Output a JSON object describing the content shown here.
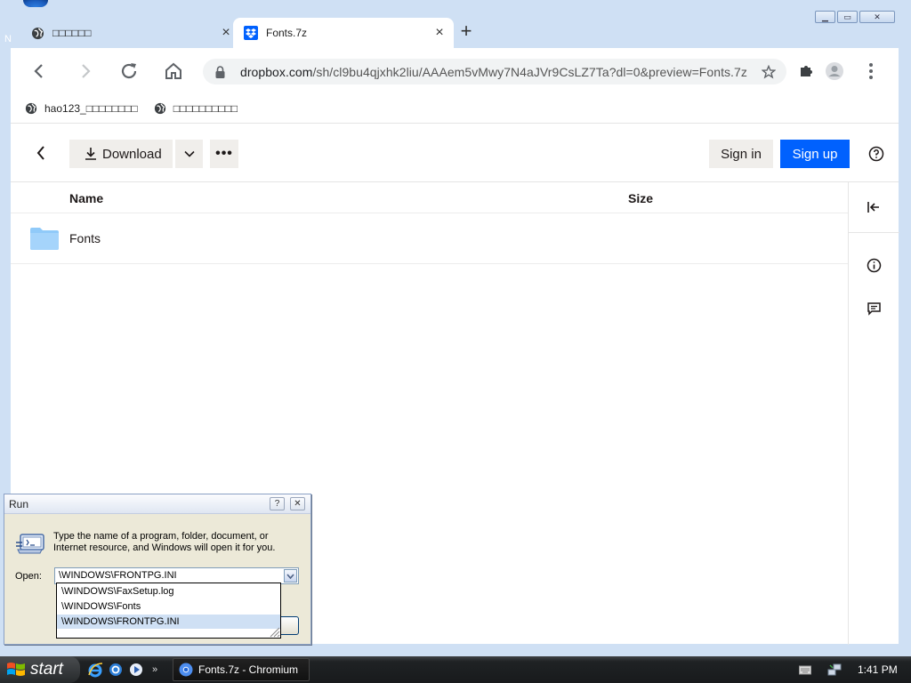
{
  "browser": {
    "tabs": [
      {
        "title": "□□□□□□",
        "active": false,
        "icon": "globe-icon"
      },
      {
        "title": "Fonts.7z",
        "active": true,
        "icon": "dropbox-icon"
      }
    ],
    "new_tab_label": "+",
    "window_controls": {
      "minimize": "▁",
      "restore": "▭",
      "close": "✕"
    },
    "address": {
      "host": "dropbox.com",
      "path": "/sh/cl9bu4qjxhk2liu/AAAem5vMwy7N4aJVr9CsLZ7Ta?dl=0&preview=Fonts.7z"
    },
    "bookmarks": [
      {
        "label": "hao123_□□□□□□□□",
        "icon": "globe-icon"
      },
      {
        "label": "□□□□□□□□□□",
        "icon": "globe-icon"
      }
    ]
  },
  "dropbox": {
    "download_label": "Download",
    "more_label": "•••",
    "signin_label": "Sign in",
    "signup_label": "Sign up",
    "columns": {
      "name": "Name",
      "size": "Size"
    },
    "rows": [
      {
        "name": "Fonts",
        "size": "",
        "icon": "folder-icon"
      }
    ],
    "colors": {
      "accent": "#0061fe",
      "folder": "#90caf9",
      "button_bg": "#f0eeeb"
    }
  },
  "run_dialog": {
    "title": "Run",
    "help_label": "?",
    "close_label": "✕",
    "description": "Type the name of a program, folder, document, or Internet resource, and Windows will open it for you.",
    "open_label": "Open:",
    "open_value": "\\WINDOWS\\FRONTPG.INI",
    "suggestions": [
      {
        "text": "\\WINDOWS\\FaxSetup.log",
        "selected": false
      },
      {
        "text": "\\WINDOWS\\Fonts",
        "selected": false
      },
      {
        "text": "\\WINDOWS\\FRONTPG.INI",
        "selected": true
      }
    ]
  },
  "taskbar": {
    "start_label": "start",
    "quick_launch_more": "»",
    "task_item": "Fonts.7z - Chromium",
    "clock": "1:41 PM"
  },
  "desktop": {
    "peek_letter": "N"
  }
}
